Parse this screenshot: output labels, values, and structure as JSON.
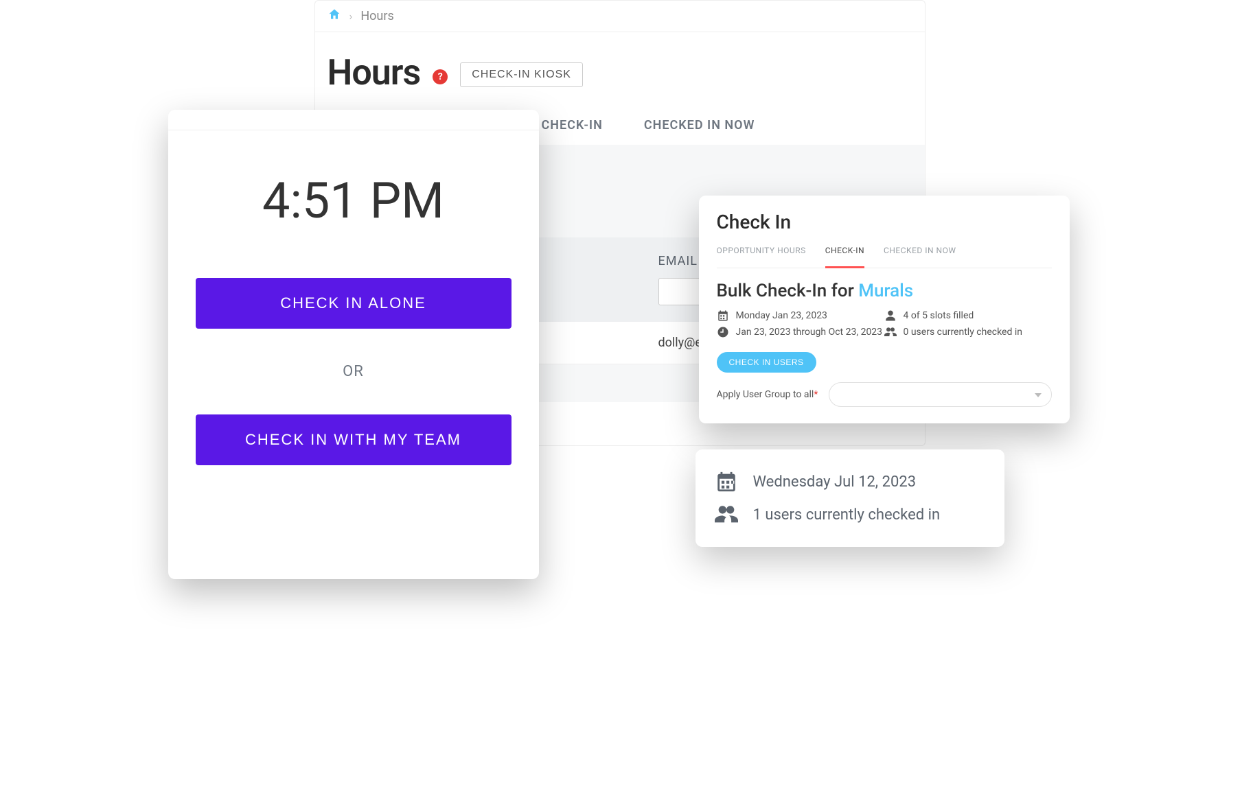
{
  "breadcrumb": {
    "current": "Hours"
  },
  "hours": {
    "title": "Hours",
    "kiosk_btn": "CHECK-IN KIOSK",
    "tabs": {
      "checkin": "CHECK-IN",
      "checked_in_now": "CHECKED IN NOW"
    },
    "email_header": "EMAIL",
    "row_email": "dolly@e"
  },
  "kiosk": {
    "time": "4:51 PM",
    "alone_btn": "CHECK IN ALONE",
    "or": "OR",
    "team_btn": "CHECK IN WITH MY TEAM"
  },
  "bulk": {
    "header": "Check In",
    "tabs": {
      "opp": "OPPORTUNITY HOURS",
      "checkin": "CHECK-IN",
      "now": "CHECKED IN NOW"
    },
    "title_prefix": "Bulk Check-In for ",
    "title_link": "Murals",
    "date": "Monday Jan 23, 2023",
    "range": "Jan 23, 2023 through Oct 23, 2023",
    "slots": "4 of 5 slots filled",
    "checked": "0 users currently checked in",
    "btn": "CHECK IN USERS",
    "apply_label": "Apply User Group to all"
  },
  "summary": {
    "date": "Wednesday Jul 12, 2023",
    "checked": "1 users currently checked in"
  }
}
